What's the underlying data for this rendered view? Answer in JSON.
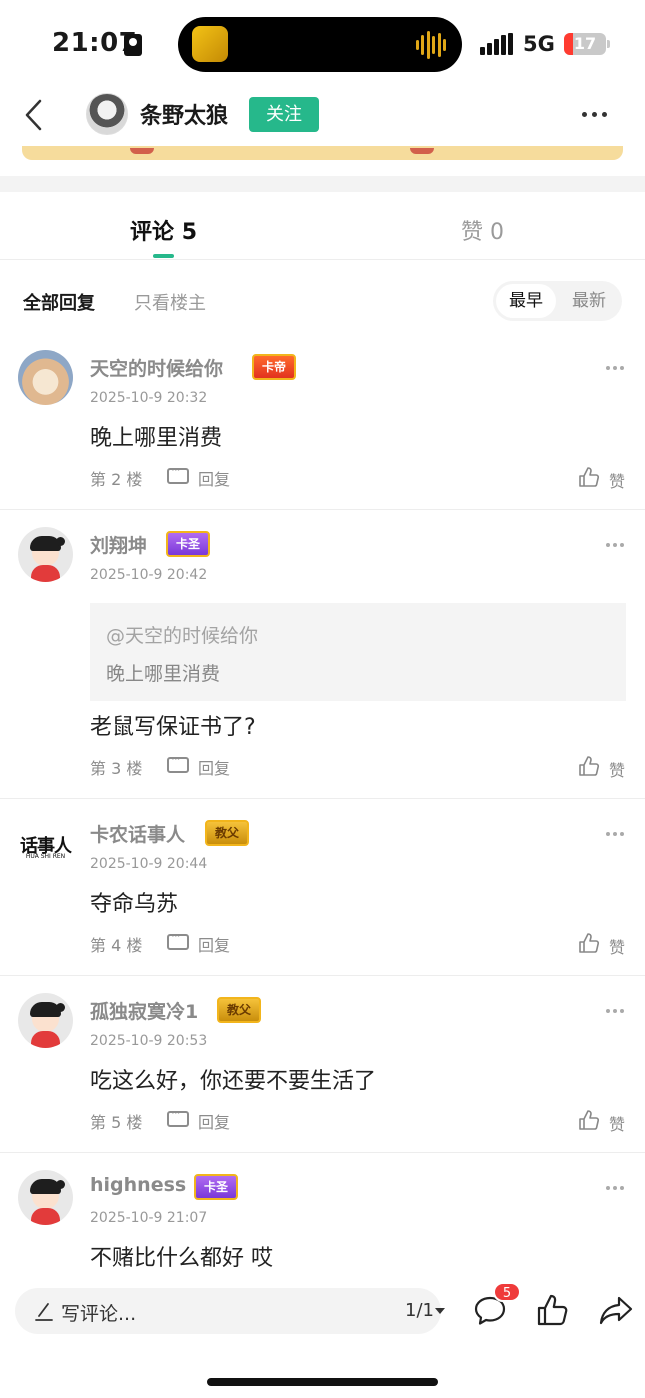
{
  "status_bar": {
    "time": "21:07",
    "network": "5G",
    "battery": "17"
  },
  "header": {
    "author": "条野太狼",
    "follow_label": "关注"
  },
  "tabs": {
    "comments_label": "评论",
    "comments_count": "5",
    "likes_label": "赞",
    "likes_count": "0"
  },
  "filters": {
    "all": "全部回复",
    "op_only": "只看楼主",
    "earliest": "最早",
    "latest": "最新"
  },
  "comments": [
    {
      "name": "天空的时候给你",
      "badge": "卡帝",
      "time": "2025-10-9 20:32",
      "text": "晚上哪里消费",
      "floor": "第 2 楼",
      "reply": "回复",
      "like": "赞"
    },
    {
      "name": "刘翔坤",
      "badge": "卡圣",
      "time": "2025-10-9 20:42",
      "quote_at": "@天空的时候给你",
      "quote_text": "晚上哪里消费",
      "text": "老鼠写保证书了?",
      "floor": "第 3 楼",
      "reply": "回复",
      "like": "赞"
    },
    {
      "name": "卡农话事人",
      "badge": "教父",
      "logo_main": "话事人",
      "logo_sub": "HUA SHI REN",
      "time": "2025-10-9 20:44",
      "text": "夺命乌苏",
      "floor": "第 4 楼",
      "reply": "回复",
      "like": "赞"
    },
    {
      "name": "孤独寂寞冷1",
      "badge": "教父",
      "time": "2025-10-9 20:53",
      "text": "吃这么好，你还要不要生活了",
      "floor": "第 5 楼",
      "reply": "回复",
      "like": "赞"
    },
    {
      "name": "highness",
      "badge": "卡圣",
      "time": "2025-10-9 21:07",
      "text": "不赌比什么都好 哎"
    }
  ],
  "bottom_bar": {
    "placeholder": "写评论...",
    "pager": "1/1",
    "comment_count": "5"
  },
  "colors": {
    "accent": "#26b88b",
    "badge_red": "#ef3b3b"
  }
}
